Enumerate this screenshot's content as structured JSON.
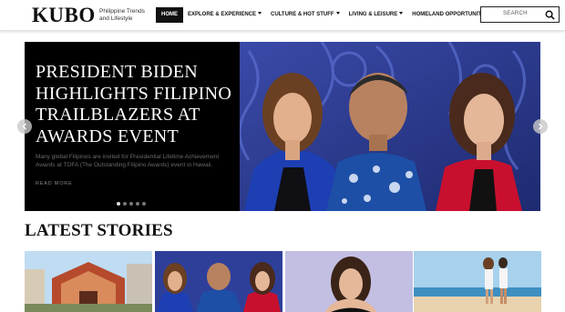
{
  "brand": {
    "logo": "KUBO",
    "tagline": "Philippine Trends and Lifestyle"
  },
  "nav": {
    "items": [
      {
        "label": "HOME",
        "active": true,
        "dropdown": false
      },
      {
        "label": "EXPLORE & EXPERIENCE",
        "active": false,
        "dropdown": true
      },
      {
        "label": "CULTURE & HOT STUFF",
        "active": false,
        "dropdown": true
      },
      {
        "label": "LIVING & LEISURE",
        "active": false,
        "dropdown": true
      },
      {
        "label": "HOMELAND OPPORTUNITIES",
        "active": false,
        "dropdown": true
      }
    ]
  },
  "search": {
    "placeholder": "SEARCH",
    "icon": "search-icon"
  },
  "hero": {
    "title": "PRESIDENT BIDEN HIGHLIGHTS FILIPINO TRAILBLAZERS AT AWARDS EVENT",
    "excerpt": "Many global Filipinos are invited for Presidential Lifetime Achievement Awards at TOFA (The Outstanding Filipino Awards) event in Hawaii.",
    "read_more": "READ MORE",
    "slides": 5,
    "active_slide": 1,
    "prev_icon": "chevron-left-icon",
    "next_icon": "chevron-right-icon"
  },
  "latest": {
    "heading": "LATEST STORIES"
  },
  "colors": {
    "nav_active_bg": "#111111",
    "hero_bg": "#000000",
    "hero_photo_bg": "#2c3a8a"
  }
}
